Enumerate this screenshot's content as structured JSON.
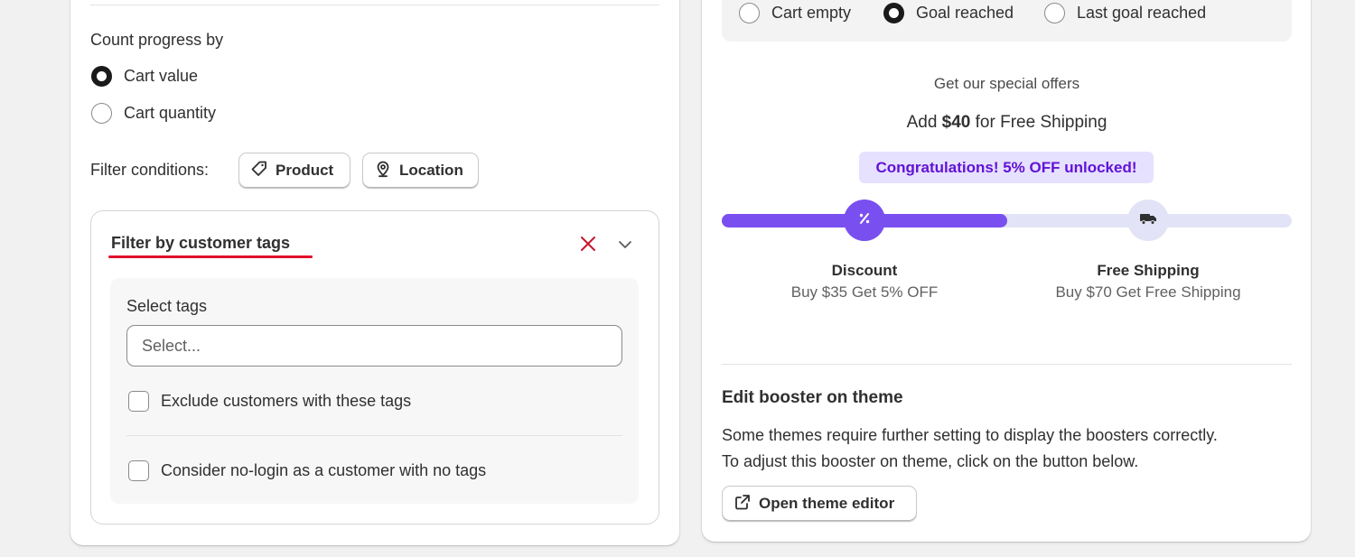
{
  "left": {
    "count_progress": {
      "label": "Count progress by",
      "options": [
        {
          "label": "Cart value",
          "selected": true
        },
        {
          "label": "Cart quantity",
          "selected": false
        }
      ]
    },
    "filter_conditions": {
      "label": "Filter conditions:",
      "buttons": [
        {
          "label": "Product",
          "icon": "tag-icon"
        },
        {
          "label": "Location",
          "icon": "location-pin-icon"
        }
      ]
    },
    "customer_tags_filter": {
      "title": "Filter by customer tags",
      "select_label": "Select tags",
      "select_placeholder": "Select...",
      "checkboxes": [
        {
          "label": "Exclude customers with these tags",
          "checked": false
        },
        {
          "label": "Consider no-login as a customer with no tags",
          "checked": false
        }
      ]
    }
  },
  "right": {
    "preview_states": [
      {
        "label": "Cart empty",
        "selected": false
      },
      {
        "label": "Goal reached",
        "selected": true
      },
      {
        "label": "Last goal reached",
        "selected": false
      }
    ],
    "preview": {
      "heading": "Get our special offers",
      "message_prefix": "Add ",
      "message_amount": "$40",
      "message_suffix": " for Free Shipping",
      "badge": "Congratulations! 5% OFF unlocked!",
      "progress": 0.5,
      "milestones": [
        {
          "title": "Discount",
          "subtitle": "Buy $35 Get 5% OFF",
          "icon": "percent-icon",
          "reached": true
        },
        {
          "title": "Free Shipping",
          "subtitle": "Buy $70 Get Free Shipping",
          "icon": "truck-icon",
          "reached": false
        }
      ]
    },
    "edit_booster": {
      "title": "Edit booster on theme",
      "description_line1": "Some themes require further setting to display the boosters correctly.",
      "description_line2": "To adjust this booster on theme, click on the button below.",
      "button_label": "Open theme editor",
      "button_icon": "external-link-icon"
    }
  },
  "colors": {
    "accent": "#7a4ff0",
    "track": "#e2e3f6",
    "badge_bg": "#e5e1ff",
    "badge_text": "#6212d6",
    "annotation_red": "#e0112b",
    "remove_icon": "#c5162b"
  }
}
